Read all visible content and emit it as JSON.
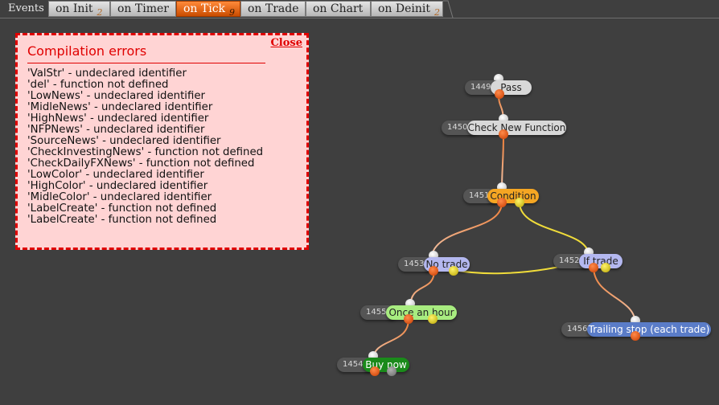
{
  "tabs": {
    "label": "Events",
    "items": [
      {
        "name": "on Init",
        "count": "2"
      },
      {
        "name": "on Timer",
        "count": ""
      },
      {
        "name": "on Tick",
        "count": "9"
      },
      {
        "name": "on Trade",
        "count": ""
      },
      {
        "name": "on Chart",
        "count": ""
      },
      {
        "name": "on Deinit",
        "count": "2"
      }
    ],
    "active": "on Tick"
  },
  "errors": {
    "title": "Compilation errors",
    "close_label": "Close",
    "lines": [
      "'ValStr' - undeclared identifier",
      "'del' - function not defined",
      "'LowNews' - undeclared identifier",
      "'MidleNews' - undeclared identifier",
      "'HighNews' - undeclared identifier",
      "'NFPNews' - undeclared identifier",
      "'SourceNews' - undeclared identifier",
      "'CheckInvestingNews' - function not defined",
      "'CheckDailyFXNews' - function not defined",
      "'LowColor' - undeclared identifier",
      "'HighColor' - undeclared identifier",
      "'MidleColor' - undeclared identifier",
      "'LabelCreate' - function not defined",
      "'LabelCreate' - function not defined"
    ]
  },
  "nodes": [
    {
      "id": "1449",
      "label": "Pass",
      "color": "#d8d8d8",
      "text_color": "#222222"
    },
    {
      "id": "1450",
      "label": "Check New Function",
      "color": "#d8d8d8",
      "text_color": "#222222"
    },
    {
      "id": "1451",
      "label": "Condition",
      "color": "#f5a623",
      "text_color": "#222222"
    },
    {
      "id": "1453",
      "label": "No trade",
      "color": "#b4b8f0",
      "text_color": "#222222"
    },
    {
      "id": "1452",
      "label": "If trade",
      "color": "#b4b8f0",
      "text_color": "#222222"
    },
    {
      "id": "1455",
      "label": "Once an hour",
      "color": "#a8ec80",
      "text_color": "#222222"
    },
    {
      "id": "1456",
      "label": "Trailing stop (each trade)",
      "color": "#5a7cc8",
      "text_color": "#ffffff"
    },
    {
      "id": "1454",
      "label": "Buy now",
      "color": "#1a8a1a",
      "text_color": "#ffffff"
    }
  ],
  "colors": {
    "error_red": "#e00000",
    "error_bg": "#ffd4d4",
    "active_tab": "#e8650d",
    "wire_true": "#f07a30",
    "wire_false": "#f0dc3a",
    "background": "#3f3f3f"
  }
}
